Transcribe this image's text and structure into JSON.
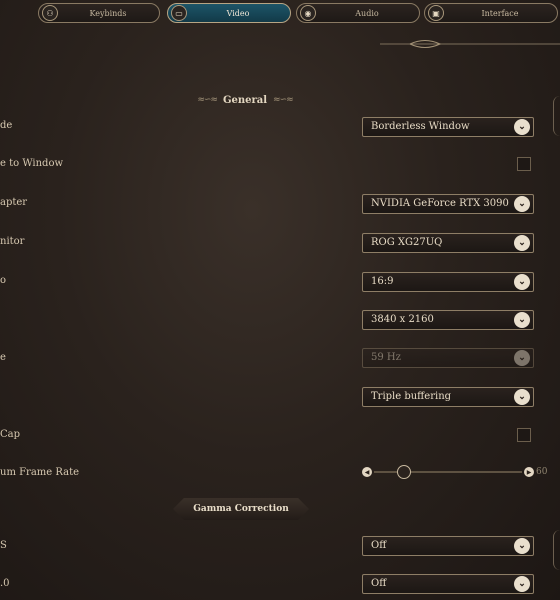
{
  "tabs": [
    {
      "label": "Keybinds",
      "icon": "gamepad-icon",
      "active": false
    },
    {
      "label": "Video",
      "icon": "monitor-icon",
      "active": true
    },
    {
      "label": "Audio",
      "icon": "speaker-icon",
      "active": false
    },
    {
      "label": "Interface",
      "icon": "interface-icon",
      "active": false
    }
  ],
  "section": {
    "title": "General"
  },
  "rows": {
    "display_mode": {
      "label": "de",
      "value": "Borderless Window"
    },
    "clamp_window": {
      "label": "e to Window"
    },
    "adapter": {
      "label": "apter",
      "value": "NVIDIA GeForce RTX 3090"
    },
    "monitor": {
      "label": "nitor",
      "value": "ROG XG27UQ"
    },
    "aspect": {
      "label": "o",
      "value": "16:9"
    },
    "resolution": {
      "label": "",
      "value": "3840 x 2160"
    },
    "refresh": {
      "label": "e",
      "value": "59 Hz"
    },
    "vsync": {
      "label": "",
      "value": "Triple buffering"
    },
    "frame_cap": {
      "label": "Cap"
    },
    "max_frame_rate": {
      "label": "um Frame Rate",
      "value": "60",
      "slider_fraction": 0.2
    },
    "dlss": {
      "label": "S",
      "value": "Off"
    },
    "last": {
      "label": ".0",
      "value": "Off"
    }
  },
  "gamma": {
    "label": "Gamma Correction"
  },
  "colors": {
    "active_tab": "#1d5568",
    "accent": "#e9dfcd",
    "background": "#2a221d"
  }
}
